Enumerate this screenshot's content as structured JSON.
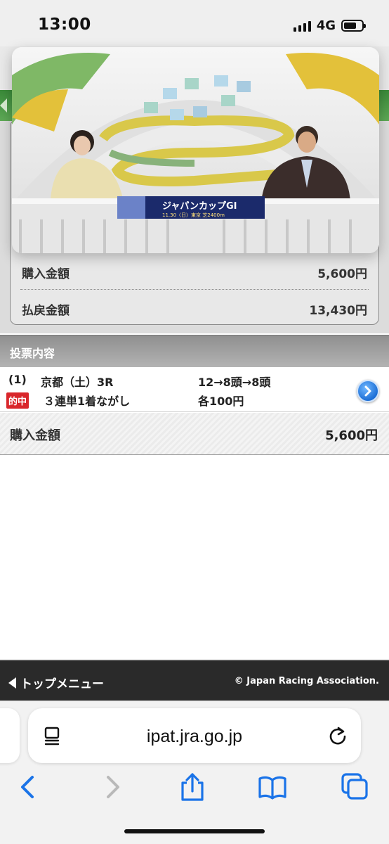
{
  "status_bar": {
    "time": "13:00",
    "network": "4G"
  },
  "summary": {
    "purchase_label": "購入金額",
    "purchase_value": "5,600円",
    "payout_label": "払戻金額",
    "payout_value": "13,430円"
  },
  "video": {
    "program_title": "ジャパンカップGI",
    "program_sub": "11.30〈日〉東京 芝2400m"
  },
  "section": {
    "title": "投票内容"
  },
  "bet": {
    "number": "(1)",
    "race": "京都（土）3R",
    "combination": "12→8頭→8頭",
    "hit_badge": "的中",
    "type": "３連単1着ながし",
    "amount": "各100円"
  },
  "total": {
    "label": "購入金額",
    "value": "5,600円"
  },
  "footer": {
    "menu_label": "トップメニュー",
    "copyright": "© Japan Racing Association."
  },
  "browser": {
    "url": "ipat.jra.go.jp"
  },
  "colors": {
    "hit_badge": "#d9262b",
    "next_button": "#1d6fd6",
    "footer_bg": "#2a2a2a",
    "green_band": "#4a9a46"
  }
}
